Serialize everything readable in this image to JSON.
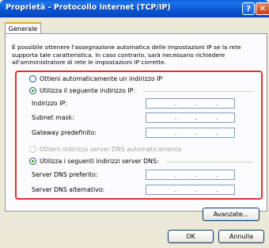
{
  "window": {
    "title": "Proprietà - Protocollo Internet (TCP/IP)",
    "help_glyph": "?",
    "close_glyph": "✕"
  },
  "tabs": [
    {
      "label": "Generale",
      "selected": true
    }
  ],
  "intro_text": "È possibile ottenere l'assegnazione automatica delle impostazioni IP se la rete supporta tale caratteristica. In caso contrario, sarà necessario richiedere all'amministratore di rete le impostazioni IP corrette.",
  "ip_options": {
    "auto_label": "Ottieni automaticamente un indirizzo IP",
    "manual_label": "Utilizza il seguente indirizzo IP:",
    "selected": "manual"
  },
  "ip_fields": [
    {
      "label": "Indirizzo IP:",
      "value": ". . ."
    },
    {
      "label": "Subnet mask:",
      "value": ". . ."
    },
    {
      "label": "Gateway predefinito:",
      "value": ". . ."
    }
  ],
  "dns_options": {
    "auto_label": "Ottieni indirizzo server DNS automaticamente",
    "manual_label": "Utilizza i seguenti indirizzi server DNS:",
    "selected": "manual",
    "auto_disabled": true
  },
  "dns_fields": [
    {
      "label": "Server DNS preferito:",
      "value": ". . ."
    },
    {
      "label": "Server DNS alternativo:",
      "value": ". . ."
    }
  ],
  "buttons": {
    "advanced": "Avanzate...",
    "ok": "OK",
    "cancel": "Annulla"
  },
  "colors": {
    "highlight_border": "#e03030",
    "titlebar": "#0b58d6"
  }
}
